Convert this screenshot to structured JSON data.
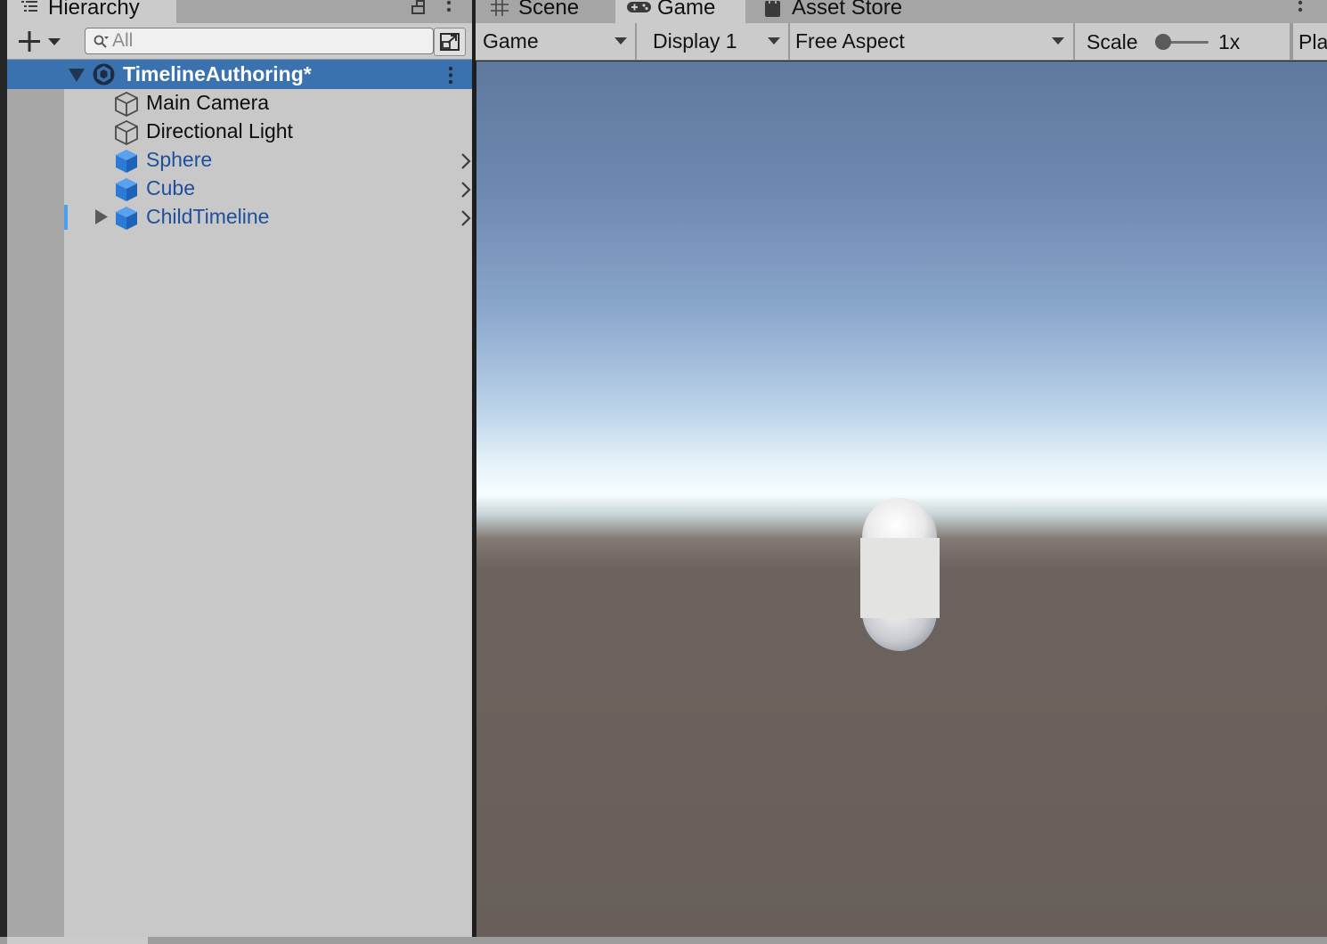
{
  "hierarchy": {
    "tab_label": "Hierarchy",
    "search": {
      "placeholder": "All",
      "value": ""
    },
    "scene": {
      "name": "TimelineAuthoring*"
    },
    "objects": [
      {
        "name": "Main Camera",
        "kind": "plain"
      },
      {
        "name": "Directional Light",
        "kind": "plain"
      },
      {
        "name": "Sphere",
        "kind": "prefab"
      },
      {
        "name": "Cube",
        "kind": "prefab"
      },
      {
        "name": "ChildTimeline",
        "kind": "prefab"
      }
    ]
  },
  "tabs": [
    {
      "label": "Scene",
      "icon": "grid-icon",
      "active": false
    },
    {
      "label": "Game",
      "icon": "gamepad-icon",
      "active": true
    },
    {
      "label": "Asset Store",
      "icon": "shopping-bag-icon",
      "active": false
    }
  ],
  "game_toolbar": {
    "view_dropdown": "Game",
    "display_dropdown": "Display 1",
    "aspect_dropdown": "Free Aspect",
    "scale_label": "Scale",
    "scale_value": "1x",
    "scale_slider_level": 0,
    "play_label_partial": "Pla"
  },
  "colors": {
    "panel_bg": "#c8c8c8",
    "selection": "#3a72b0",
    "prefab_text": "#1f4f9c",
    "prefab_icon": "#2b7bd6",
    "ground": "#685f5a",
    "sky_top": "#5e789e"
  }
}
